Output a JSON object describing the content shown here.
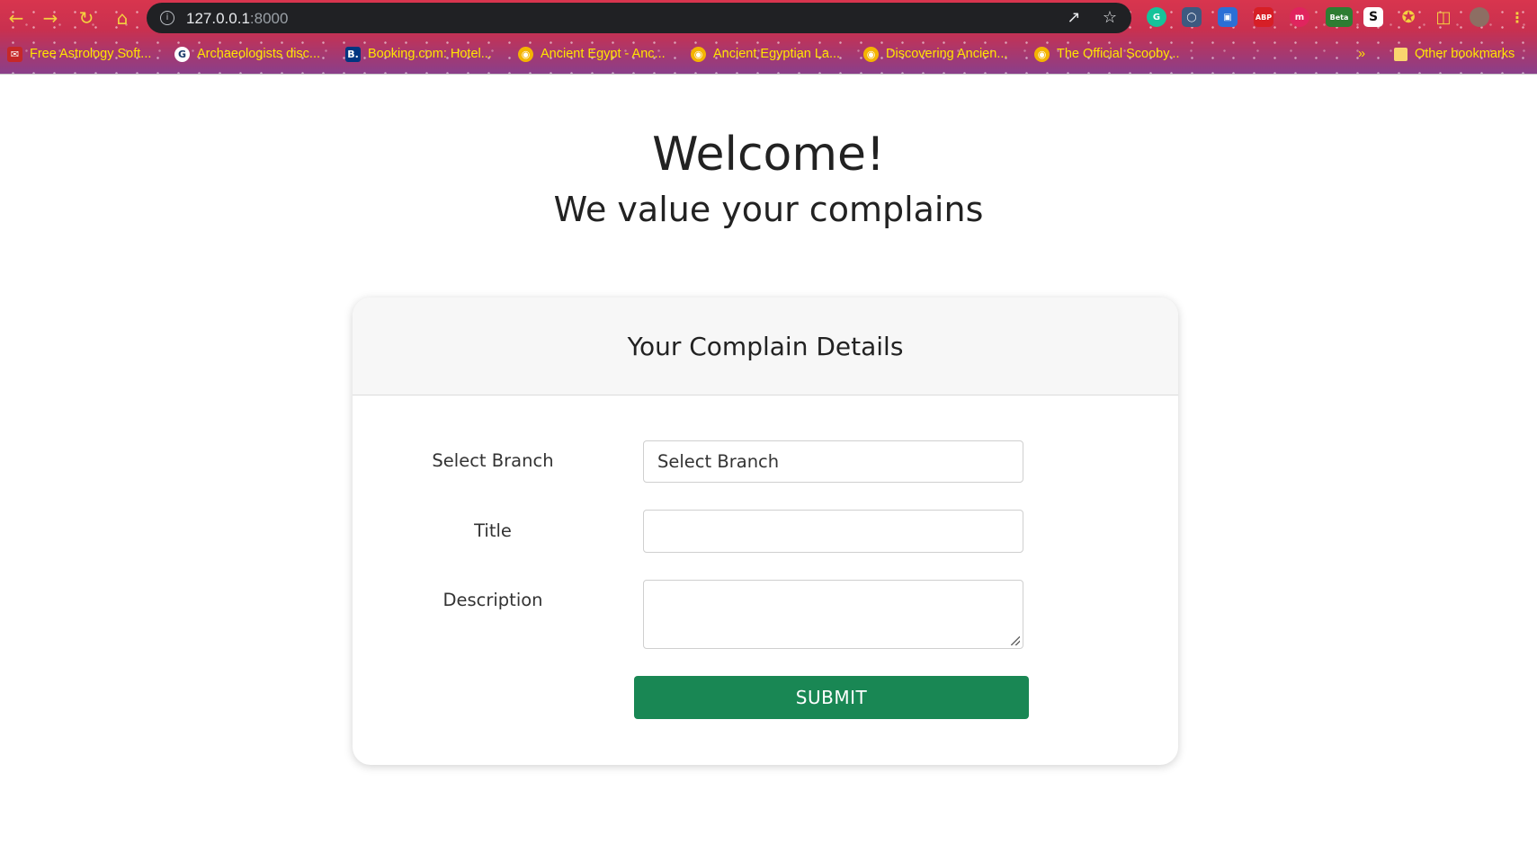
{
  "browser": {
    "url_host": "127.0.0.1",
    "url_port": ":8000",
    "bookmarks": [
      {
        "label": "Free Astrology Soft..."
      },
      {
        "label": "Archaeologists disc..."
      },
      {
        "label": "Booking.com: Hotel..."
      },
      {
        "label": "Ancient Egypt - Anc..."
      },
      {
        "label": "Ancient Egyptian La..."
      },
      {
        "label": "Discovering Ancien..."
      },
      {
        "label": "The Official Scooby..."
      }
    ],
    "bookmarks_overflow": "»",
    "other_bookmarks": "Other bookmarks",
    "extensions": {
      "abp": "ABP",
      "beta": "Beta",
      "s": "S"
    }
  },
  "page": {
    "heading": "Welcome!",
    "subheading": "We value your complains"
  },
  "form": {
    "title": "Your Complain Details",
    "branch_label": "Select Branch",
    "branch_value": "Select Branch",
    "title_label": "Title",
    "title_value": "",
    "description_label": "Description",
    "description_value": "",
    "submit_label": "SUBMIT"
  },
  "colors": {
    "submit": "#198754",
    "bookmark_text": "#ffe600"
  }
}
